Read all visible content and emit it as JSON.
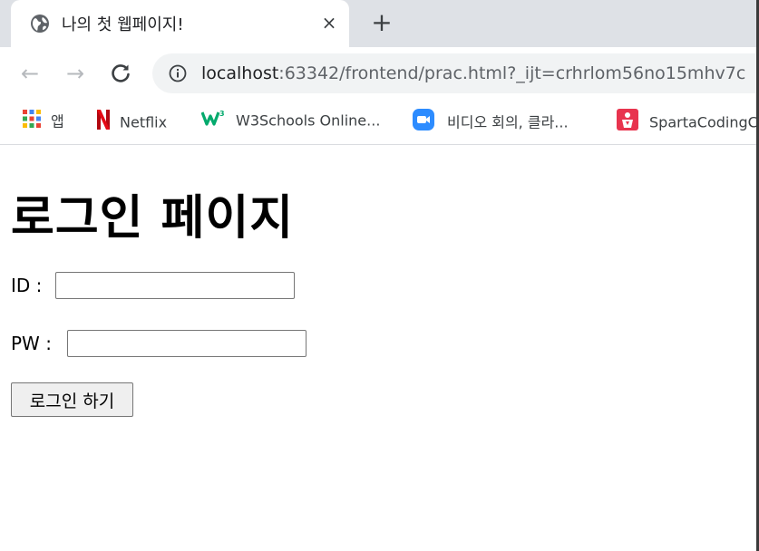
{
  "tab": {
    "title": "나의 첫 웹페이지!",
    "close_glyph": "×",
    "favicon": "globe-icon"
  },
  "new_tab_glyph": "+",
  "toolbar": {
    "back_glyph": "←",
    "forward_glyph": "→",
    "reload_glyph": "↻",
    "url_host": "localhost",
    "url_rest": ":63342/frontend/prac.html?_ijt=crhrlom56no15mhv7c"
  },
  "bookmarks": [
    {
      "label": "앱",
      "icon": "apps-grid-icon"
    },
    {
      "label": "Netflix",
      "icon": "netflix-icon"
    },
    {
      "label": "W3Schools Online...",
      "icon": "w3schools-icon"
    },
    {
      "label": "비디오 회의, 클라...",
      "icon": "zoom-icon"
    },
    {
      "label": "SpartaCodingC",
      "icon": "spartacoding-icon"
    }
  ],
  "page": {
    "title": "로그인 페이지",
    "id_label": "ID :",
    "id_value": "",
    "pw_label": "PW :",
    "pw_value": "",
    "login_button": "로그인 하기"
  },
  "colors": {
    "tabstrip_bg": "#dee1e6",
    "omnibox_bg": "#f1f3f4",
    "netflix_red": "#e50914",
    "w3_green": "#04aa6d",
    "zoom_blue": "#2d8cff",
    "sparta_red": "#e8344e"
  }
}
